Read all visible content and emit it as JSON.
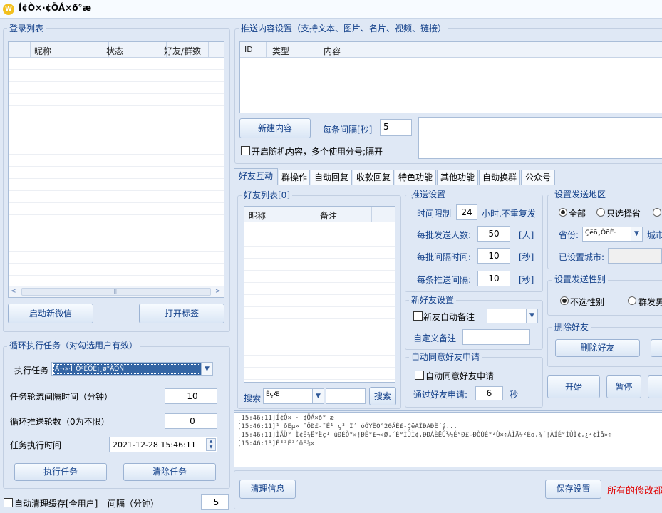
{
  "window": {
    "title": "Í¢Ò×·¢ÖÁ×ð°æ",
    "logo_text": "W"
  },
  "login_list": {
    "title": "登录列表",
    "columns": [
      "昵称",
      "状态",
      "好友/群数"
    ],
    "scroll_thumb": "|||"
  },
  "buttons": {
    "start_wechat": "启动新微信",
    "open_tag": "打开标签",
    "exec_task": "执行任务",
    "clear_task": "清除任务",
    "new_content": "新建内容",
    "search": "搜索",
    "delete_friend": "删除好友",
    "start": "开始",
    "pause": "暂停",
    "clear_info": "清理信息",
    "save_settings": "保存设置"
  },
  "loop_task": {
    "title": "循环执行任务（对勾选用户有效）",
    "task_label": "执行任务",
    "task_value": "Ã¬»·Í¨ÖªÊÕÈ¡¸ø°ÃÓÑ",
    "interval_label": "任务轮流间隔时间（分钟）",
    "interval_value": "10",
    "rounds_label": "循环推送轮数（0为不限）",
    "rounds_value": "0",
    "time_label": "任务执行时间",
    "time_value": "2021-12-28 15:46:11"
  },
  "auto_clean": {
    "label": "自动清理缓存[全用户]",
    "interval_label": "间隔（分钟）",
    "interval_value": "5"
  },
  "push_content": {
    "title": "推送内容设置（支持文本、图片、名片、视频、链接）",
    "columns": [
      "ID",
      "类型",
      "内容"
    ],
    "interval_label": "每条间隔[秒]",
    "interval_value": "5",
    "random_label": "开启随机内容，多个使用分号;隔开"
  },
  "tabs": [
    "好友互动",
    "群操作",
    "自动回复",
    "收款回复",
    "特色功能",
    "其他功能",
    "自动换群",
    "公众号"
  ],
  "friend_list": {
    "title": "好友列表[0]",
    "columns": [
      "昵称",
      "备注"
    ],
    "search_value": "ÈçÆ"
  },
  "push_settings": {
    "title": "推送设置",
    "time_limit_label": "时间限制",
    "time_limit_value": "24",
    "time_limit_suffix": "小时,不重复发",
    "batch_label": "每批发送人数:",
    "batch_value": "50",
    "batch_unit": "[人]",
    "batch_interval_label": "每批间隔时间:",
    "batch_interval_value": "10",
    "batch_interval_unit": "[秒]",
    "item_interval_label": "每条推送间隔:",
    "item_interval_value": "10",
    "item_interval_unit": "[秒]"
  },
  "new_friend": {
    "title": "新好友设置",
    "auto_remark_label": "新友自动备注",
    "custom_remark_label": "自定义备注"
  },
  "auto_accept": {
    "title": "自动同意好友申请",
    "checkbox_label": "自动同意好友申请",
    "count_label": "通过好友申请:",
    "count_value": "6",
    "count_unit": "秒"
  },
  "region": {
    "title": "设置发送地区",
    "opt_all": "全部",
    "opt_province": "只选择省",
    "province_label": "省份:",
    "province_value": "Çëñ¸ÒñÈ·",
    "city_label": "城市",
    "set_city_label": "已设置城市:"
  },
  "gender": {
    "title": "设置发送性别",
    "opt_none": "不选性别",
    "opt_group": "群发男"
  },
  "delete_friend": {
    "title": "删除好友"
  },
  "log_lines": [
    "[15:46:11]Í¢Ò× · ¢ÖÁ×ð° æ",
    "[15:46:11]¹ ðËµ» ¯ÕÐ£-¯Ê¹ ç³ Ì´ óÓÝÈÒ°20ÃÊ£-ÇëÄÍÐÄÐÈ´ý...",
    "[15:46:11]ÌÃÜ°  Ì¢Ë¾Ë°Ëç¹ ûÐÈÒ°»¦ÐÊ°£¬»Ø,´É°ÌÙÌ¢,ÐÐÁÈËÚ½¼É°Ð£-ÐÒÙÉ°²Ù×÷ÀÌÄ¼²Éõ,¾´¦ÀÍÉ°ÌÙÌ¢,¿²¢Ìå»÷",
    "[15:46:13]Ê³³É³´ðË½»"
  ],
  "footer_notice": "所有的修改都",
  "colors": {
    "accent": "#15428b",
    "notice": "#e00000",
    "background": "#dfe8f5"
  }
}
